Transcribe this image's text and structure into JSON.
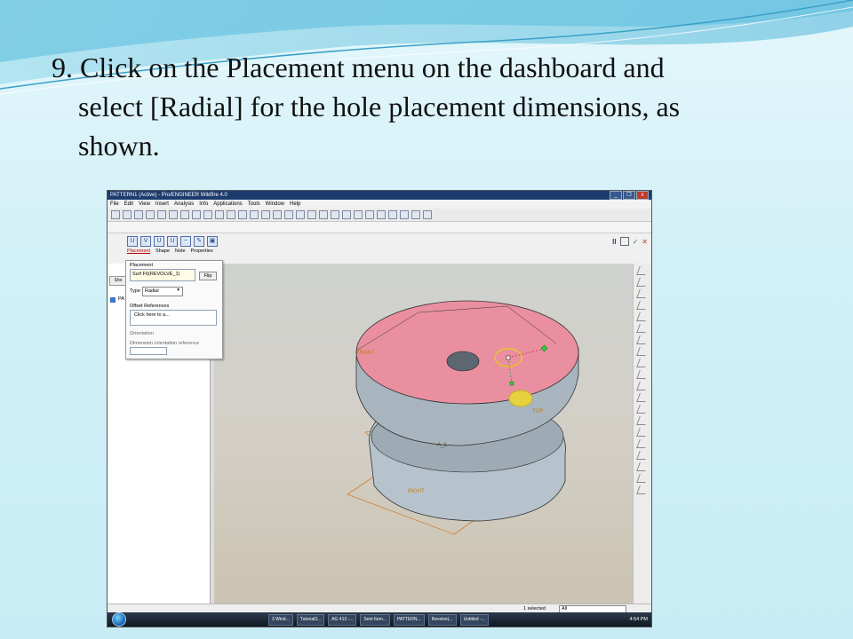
{
  "slide": {
    "title_line1": "9. Click on the Placement menu on the dashboard and",
    "title_line2": "select [Radial] for the hole placement dimensions, as",
    "title_line3": "shown."
  },
  "window": {
    "title": "PATTERN1 (Active) - Pro/ENGINEER Wildfire 4.0",
    "min_btn": "_",
    "max_btn": "❐",
    "close_btn": "x"
  },
  "menu": [
    "File",
    "Edit",
    "View",
    "Insert",
    "Analysis",
    "Info",
    "Applications",
    "Tools",
    "Window",
    "Help"
  ],
  "dashboard": {
    "tabs": [
      "Placement",
      "Shape",
      "Note",
      "Properties"
    ],
    "pause": "II",
    "ok": "✓",
    "cancel": "✕"
  },
  "placement_panel": {
    "header": "Placement",
    "surface": "Surf F6(REVOLVE_1)",
    "flip": "Flip",
    "type_label": "Type",
    "type_value": "Radial",
    "offset_refs": "Offset References",
    "click_here": "Click here to a...",
    "orientation": "Orientation",
    "dim_orient": "Dimension orientation reference"
  },
  "left_panel": {
    "show_btn": "Sho",
    "tree_label": "PA"
  },
  "model_labels": {
    "front": "FRONT",
    "top": "TOP",
    "right": "RIGHT",
    "axis": "A_1"
  },
  "status": {
    "selected": "1 selected",
    "filter": "All"
  },
  "taskbar": {
    "items": [
      "3 Wind...",
      "Tutorial3...",
      "AG 413 -...",
      "Sent Item...",
      "PATTERN...",
      "Revolve(...",
      "Untitled -..."
    ],
    "clock": "4:54 PM"
  }
}
